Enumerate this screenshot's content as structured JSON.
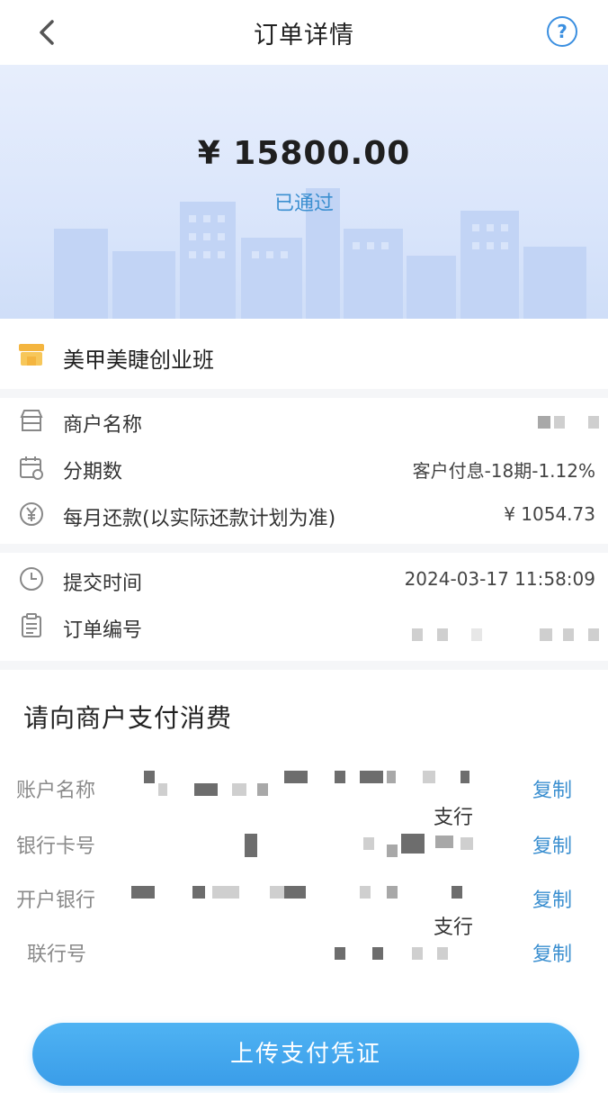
{
  "nav": {
    "title": "订单详情",
    "help_label": "?"
  },
  "hero": {
    "amount": "¥ 15800.00",
    "status": "已通过"
  },
  "course": {
    "name": "美甲美睫创业班"
  },
  "details": {
    "merchant_label": "商户名称",
    "installments_label": "分期数",
    "installments_value": "客户付息-18期-1.12%",
    "monthly_label": "每月还款(以实际还款计划为准)",
    "monthly_value": "¥ 1054.73",
    "submit_label": "提交时间",
    "submit_value": "2024-03-17 11:58:09",
    "order_label": "订单编号"
  },
  "payment": {
    "title": "请向商户支付消费",
    "rows": [
      {
        "label": "账户名称",
        "copy": "复制",
        "suffix": "支行"
      },
      {
        "label": "银行卡号",
        "copy": "复制"
      },
      {
        "label": "开户银行",
        "copy": "复制",
        "suffix": "支行"
      },
      {
        "label": "联行号",
        "copy": "复制"
      }
    ]
  },
  "upload_button": "上传支付凭证",
  "colors": {
    "accent": "#3b8fd0",
    "button": "#3a9de9",
    "hero_bg": "#dbe6fb"
  }
}
